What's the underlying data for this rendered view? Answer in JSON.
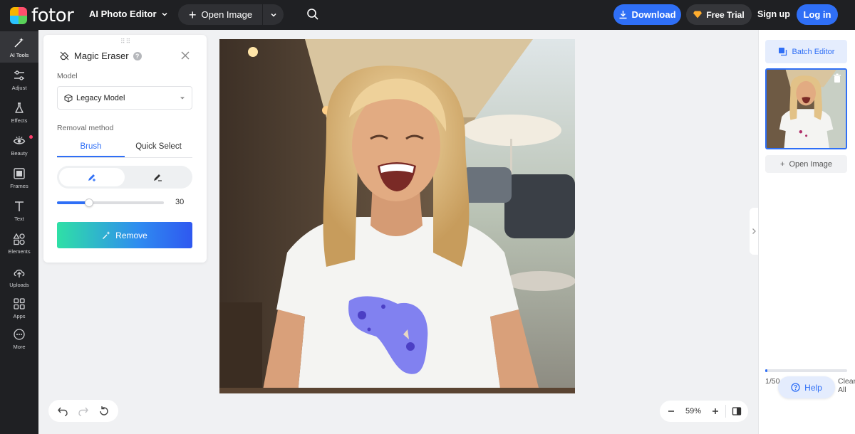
{
  "header": {
    "logo_text": "fotor",
    "product_menu": "AI Photo Editor",
    "open_image": "Open Image",
    "download": "Download",
    "free_trial": "Free Trial",
    "sign_up": "Sign up",
    "log_in": "Log in"
  },
  "sidebar": {
    "items": [
      {
        "label": "AI Tools",
        "icon": "magic-wand-icon",
        "active": true
      },
      {
        "label": "Adjust",
        "icon": "sliders-icon"
      },
      {
        "label": "Effects",
        "icon": "flask-icon"
      },
      {
        "label": "Beauty",
        "icon": "eye-icon",
        "badge": true
      },
      {
        "label": "Frames",
        "icon": "frame-icon"
      },
      {
        "label": "Text",
        "icon": "text-icon"
      },
      {
        "label": "Elements",
        "icon": "shapes-icon"
      },
      {
        "label": "Uploads",
        "icon": "upload-icon"
      },
      {
        "label": "Apps",
        "icon": "apps-icon"
      },
      {
        "label": "More",
        "icon": "more-icon"
      }
    ]
  },
  "tool_panel": {
    "title": "Magic Eraser",
    "model_label": "Model",
    "model_value": "Legacy Model",
    "removal_label": "Removal method",
    "tabs": [
      "Brush",
      "Quick Select"
    ],
    "active_tab": "Brush",
    "brush_size": "30",
    "brush_size_fraction": 0.3,
    "remove_button": "Remove"
  },
  "zoom": {
    "value": "59%"
  },
  "right_panel": {
    "batch_editor": "Batch Editor",
    "open_image": "Open Image",
    "quota": "1/50",
    "quota_fraction": 0.02,
    "clear_all": "Clear All"
  },
  "help": {
    "label": "Help"
  },
  "colors": {
    "accent": "#2f6ff6",
    "dark_bar": "#1f2023",
    "mask": "#6c6cf0",
    "gradient_start": "#2fe0a6"
  }
}
